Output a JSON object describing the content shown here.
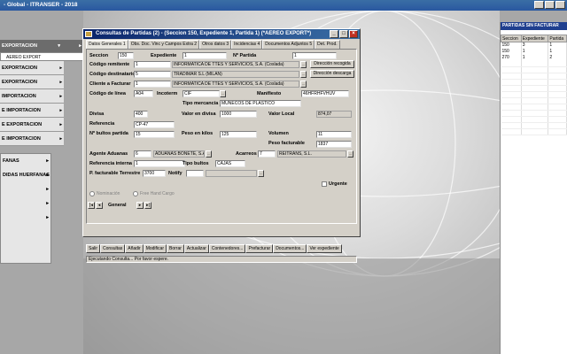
{
  "app": {
    "title": "- Global - ITRANSER - 2018"
  },
  "left_menu": {
    "header": "EXPORTACION",
    "sub": "AEREO EXPORT",
    "items": [
      {
        "label": "EXPORTACION"
      },
      {
        "label": "EXPORTACION"
      },
      {
        "label": "IMPORTACION"
      },
      {
        "label": "E IMPORTACION"
      },
      {
        "label": "E EXPORTACION"
      },
      {
        "label": "E IMPORTACION"
      }
    ],
    "lower_items": [
      {
        "label": "FANAS"
      },
      {
        "label": "DIDAS HUERFANAS"
      },
      {
        "label": ""
      },
      {
        "label": ""
      },
      {
        "label": ""
      }
    ]
  },
  "right_panel": {
    "title": "PARTIDAS SIN FACTURAR",
    "columns": [
      "Seccion",
      "Expediente",
      "Partida"
    ],
    "rows": [
      [
        "150",
        "3",
        "1"
      ],
      [
        "150",
        "1",
        "1"
      ],
      [
        "270",
        "1",
        "2"
      ]
    ]
  },
  "dialog": {
    "title": "Consultas de Partidas (2) - (Seccion 150, Expediente 1, Partida 1) (*AEREO EXPORT*)",
    "tabs": [
      "Datos Generales 1",
      "Obs. Doc. Vinc y Campos Extra 2",
      "Otros datos 3",
      "Incidencias 4",
      "Documentos Adjuntos 5",
      "Det. Prod."
    ],
    "labels": {
      "seccion": "Seccion",
      "expediente": "Expediente",
      "n_partida": "Nº Partida",
      "codigo_remitente": "Código remitente",
      "codigo_destinatario": "Código destinatario",
      "cliente_facturar": "Cliente a Facturar",
      "codigo_linea": "Código de línea",
      "incoterm": "Incoterm",
      "manifiesto": "Manifiesto",
      "tipo_mercancia": "Tipo mercancía",
      "divisa": "Divisa",
      "valor_divisa": "Valor en divisa",
      "valor_local": "Valor Local",
      "referencia": "Referencia",
      "n_bultos": "Nº bultos partida",
      "peso_kilos": "Peso en kilos",
      "volumen": "Volumen",
      "peso_facturable": "Peso facturable",
      "agente_aduanas": "Agente Aduanas",
      "acarreos": "Acarreos",
      "ref_interna": "Referencia interna",
      "tipo_bultos": "Tipo bultos",
      "p_facturable_terrestre": "P. facturable Terrestre",
      "notify": "Notify",
      "urgente": "Urgente",
      "nominacion": "Nominación",
      "free_hand_cargo": "Free Hand Cargo",
      "general": "General"
    },
    "values": {
      "seccion": "150",
      "expediente": "1",
      "n_partida": "1",
      "remitente_code": "1",
      "remitente_name": "INFORMATICA DE TTES Y SERVICIOS, S.A. (Coslada)",
      "destinatario_code": "5",
      "destinatario_name": "TRADIMAR S.L (MILAN)",
      "cliente_code": "1",
      "cliente_name": "INFORMATICA DE TTES Y SERVICIOS, S.A. (Coslada)",
      "codigo_linea": "A04",
      "incoterm": "CIF",
      "manifiesto": "46HFRHFVHUV",
      "tipo_mercancia": "MUÑECOS DE PLASTICO",
      "divisa": "400",
      "valor_divisa": "1000",
      "valor_local": "874,07",
      "referencia": "CP-47",
      "n_bultos": "15",
      "peso_kilos": "125",
      "volumen": "11",
      "peso_facturable": "1837",
      "agente_code": "6",
      "agente_name": "ADUANAS BONETE, S.A.",
      "acarreos_code": "7",
      "acarreos_name": "REITRANS, S.L.",
      "ref_interna": "1",
      "tipo_bultos": "CAJAS",
      "p_facturable_terrestre": "3700",
      "notify": ""
    },
    "buttons": {
      "direccion_recogida": "Dirección recogida",
      "direccion_descarga": "Dirección descarga"
    },
    "bottom_buttons": [
      "Salir",
      "Consultas",
      "Añadir",
      "Modificar",
      "Borrar",
      "Actualizar",
      "Contenedores...",
      "Prefacturar",
      "Documentos...",
      "Ver expediente"
    ],
    "status": "Ejecutando Consulta... Por favor espere."
  }
}
